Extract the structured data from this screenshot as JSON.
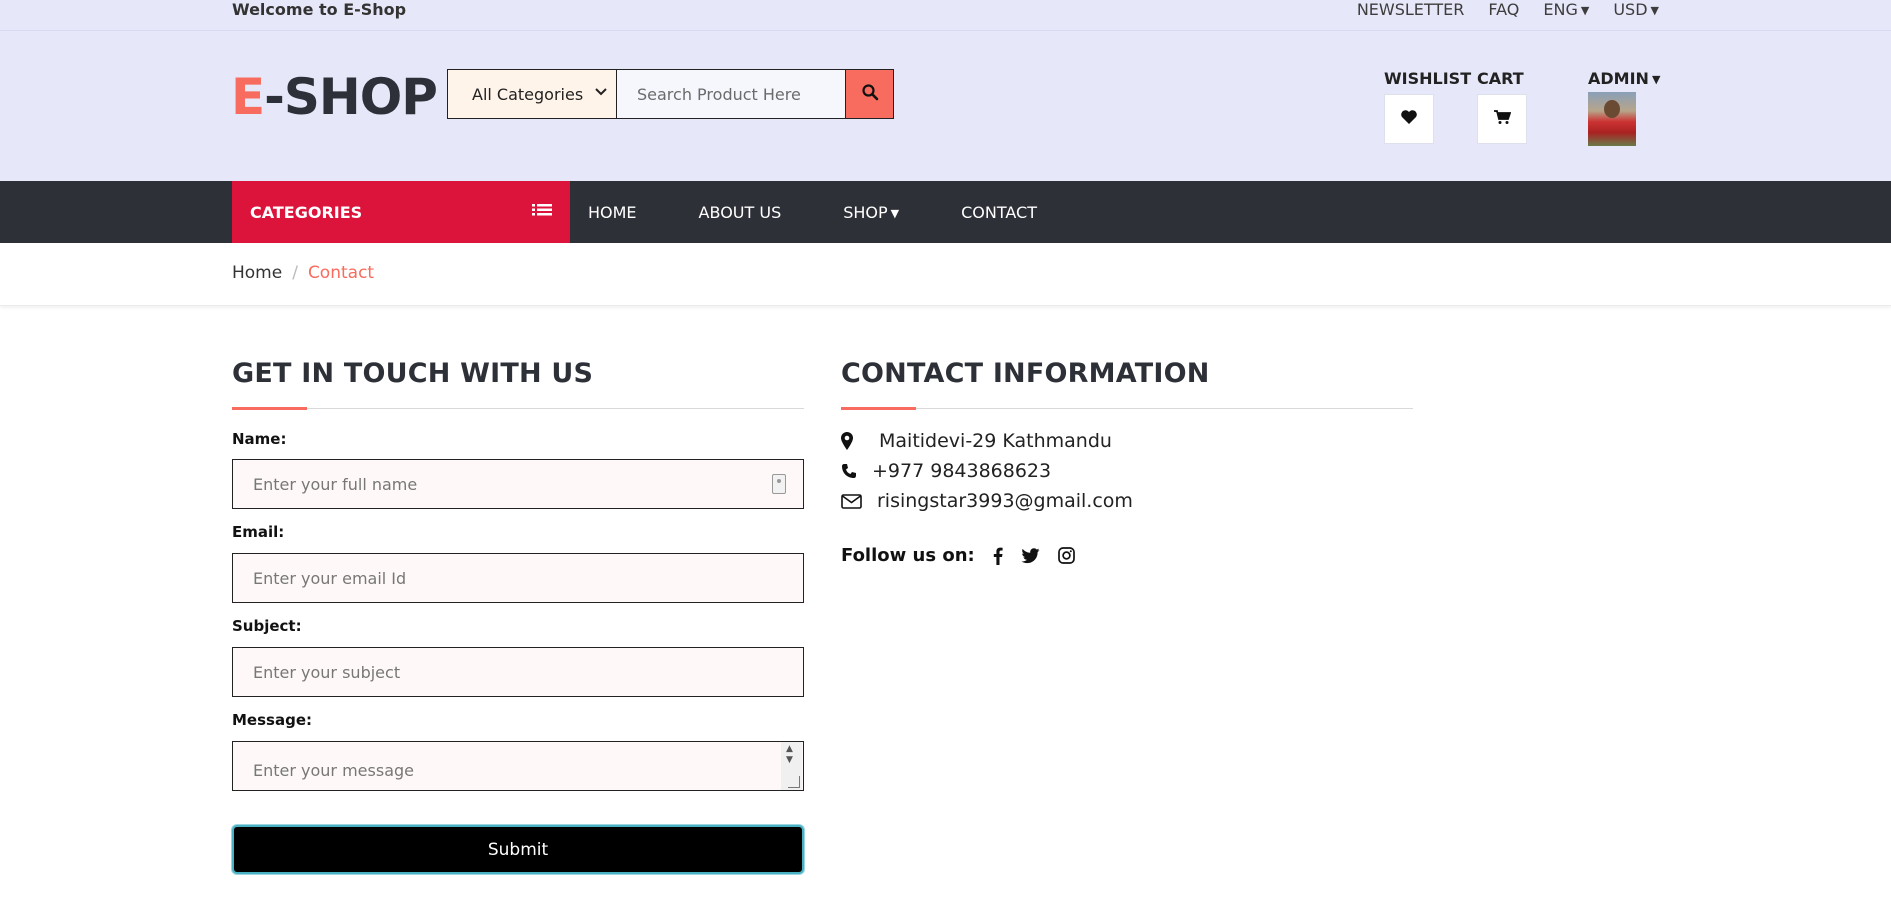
{
  "topbar": {
    "welcome": "Welcome to E-Shop",
    "links": [
      "NEWSLETTER",
      "FAQ",
      "ENG",
      "USD"
    ]
  },
  "header": {
    "logo_e": "E",
    "logo_rest": "-SHOP",
    "category_selected": "All Categories",
    "search_placeholder": "Search Product Here",
    "wishlist_label": "WISHLIST",
    "cart_label": "CART",
    "admin_label": "ADMIN"
  },
  "nav": {
    "categories_label": "CATEGORIES",
    "links": [
      "HOME",
      "ABOUT US",
      "SHOP",
      "CONTACT"
    ]
  },
  "breadcrumb": {
    "home": "Home",
    "separator": "/",
    "current": "Contact"
  },
  "form": {
    "title": "GET IN TOUCH WITH US",
    "name_label": "Name:",
    "name_placeholder": "Enter your full name",
    "email_label": "Email:",
    "email_placeholder": "Enter your email Id",
    "subject_label": "Subject:",
    "subject_placeholder": "Enter your subject",
    "message_label": "Message:",
    "message_placeholder": "Enter your message",
    "submit_label": "Submit"
  },
  "contact": {
    "title": "CONTACT INFORMATION",
    "address": "Maitidevi-29 Kathmandu",
    "phone": "+977 9843868623",
    "email": "risingstar3993@gmail.com",
    "follow_label": "Follow us on:"
  },
  "colors": {
    "accent": "#f76c5e",
    "categories_red": "#dc143c",
    "nav_dark": "#2e3038",
    "header_bg": "#e6e7f9"
  }
}
